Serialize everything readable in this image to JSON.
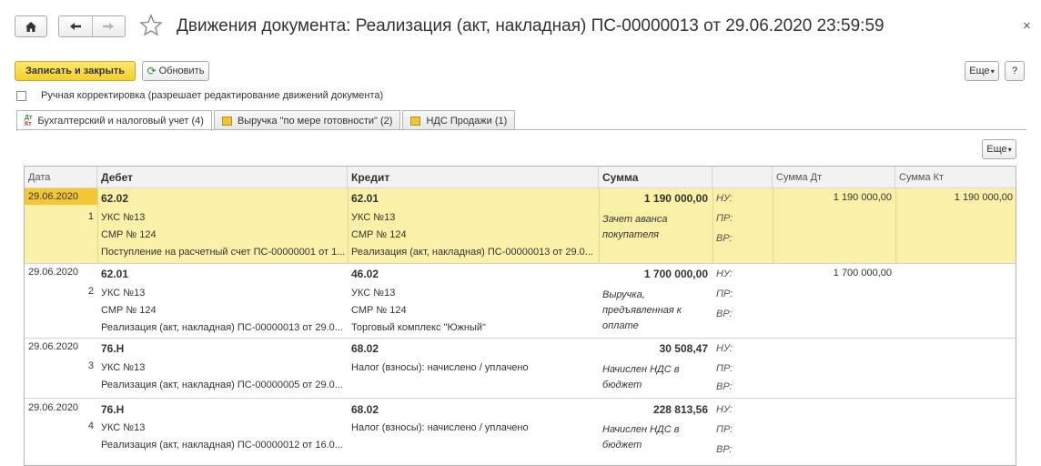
{
  "title": "Движения документа: Реализация (акт, накладная) ПС-00000013 от 29.06.2020 23:59:59",
  "close_symbol": "×",
  "toolbar": {
    "save_close_label": "Записать и закрыть",
    "refresh_label": "Обновить",
    "more_label": "Еще",
    "help_label": "?"
  },
  "manual_edit": {
    "label": "Ручная корректировка (разрешает редактирование движений документа)",
    "checked": false
  },
  "tabs": [
    {
      "label": "Бухгалтерский и налоговый учет (4)",
      "active": true
    },
    {
      "label": "Выручка \"по мере готовности\" (2)",
      "active": false
    },
    {
      "label": "НДС Продажи (1)",
      "active": false
    }
  ],
  "grid": {
    "more_label": "Еще",
    "columns": {
      "date": "Дата",
      "debit": "Дебет",
      "credit": "Кредит",
      "sum": "Сумма",
      "sum_dt": "Сумма Дт",
      "sum_kt": "Сумма Кт"
    },
    "markers": {
      "nu": "НУ:",
      "pr": "ПР:",
      "vr": "ВР:"
    },
    "rows": [
      {
        "date": "29.06.2020",
        "n": "1",
        "debit": [
          "62.02",
          "УКС №13",
          "СМР № 124",
          "Поступление на расчетный счет ПС-00000001 от 1..."
        ],
        "credit": [
          "62.01",
          "УКС №13",
          "СМР № 124",
          "Реализация (акт, накладная) ПС-00000013 от 29.0..."
        ],
        "sum": "1 190 000,00",
        "content": [
          "Зачет аванса",
          "покупателя"
        ],
        "sum_dt": "1 190 000,00",
        "sum_kt": "1 190 000,00"
      },
      {
        "date": "29.06.2020",
        "n": "2",
        "debit": [
          "62.01",
          "УКС №13",
          "СМР № 124",
          "Реализация (акт, накладная) ПС-00000013 от 29.0..."
        ],
        "credit": [
          "46.02",
          "УКС №13",
          "СМР № 124",
          "Торговый комплекс \"Южный\""
        ],
        "sum": "1 700 000,00",
        "content": [
          "Выручка,",
          "предъявленная к",
          "оплате"
        ],
        "sum_dt": "1 700 000,00",
        "sum_kt": ""
      },
      {
        "date": "29.06.2020",
        "n": "3",
        "debit": [
          "76.Н",
          "УКС №13",
          "Реализация (акт, накладная) ПС-00000005 от 29.0..."
        ],
        "credit": [
          "68.02",
          "Налог (взносы): начислено / уплачено"
        ],
        "sum": "30 508,47",
        "content": [
          "Начислен НДС в",
          "бюджет"
        ],
        "sum_dt": "",
        "sum_kt": ""
      },
      {
        "date": "29.06.2020",
        "n": "4",
        "debit": [
          "76.Н",
          "УКС №13",
          "Реализация (акт, накладная) ПС-00000012 от 16.0..."
        ],
        "credit": [
          "68.02",
          "Налог (взносы): начислено / уплачено"
        ],
        "sum": "228 813,56",
        "content": [
          "Начислен НДС в",
          "бюджет"
        ],
        "sum_dt": "",
        "sum_kt": ""
      }
    ]
  }
}
